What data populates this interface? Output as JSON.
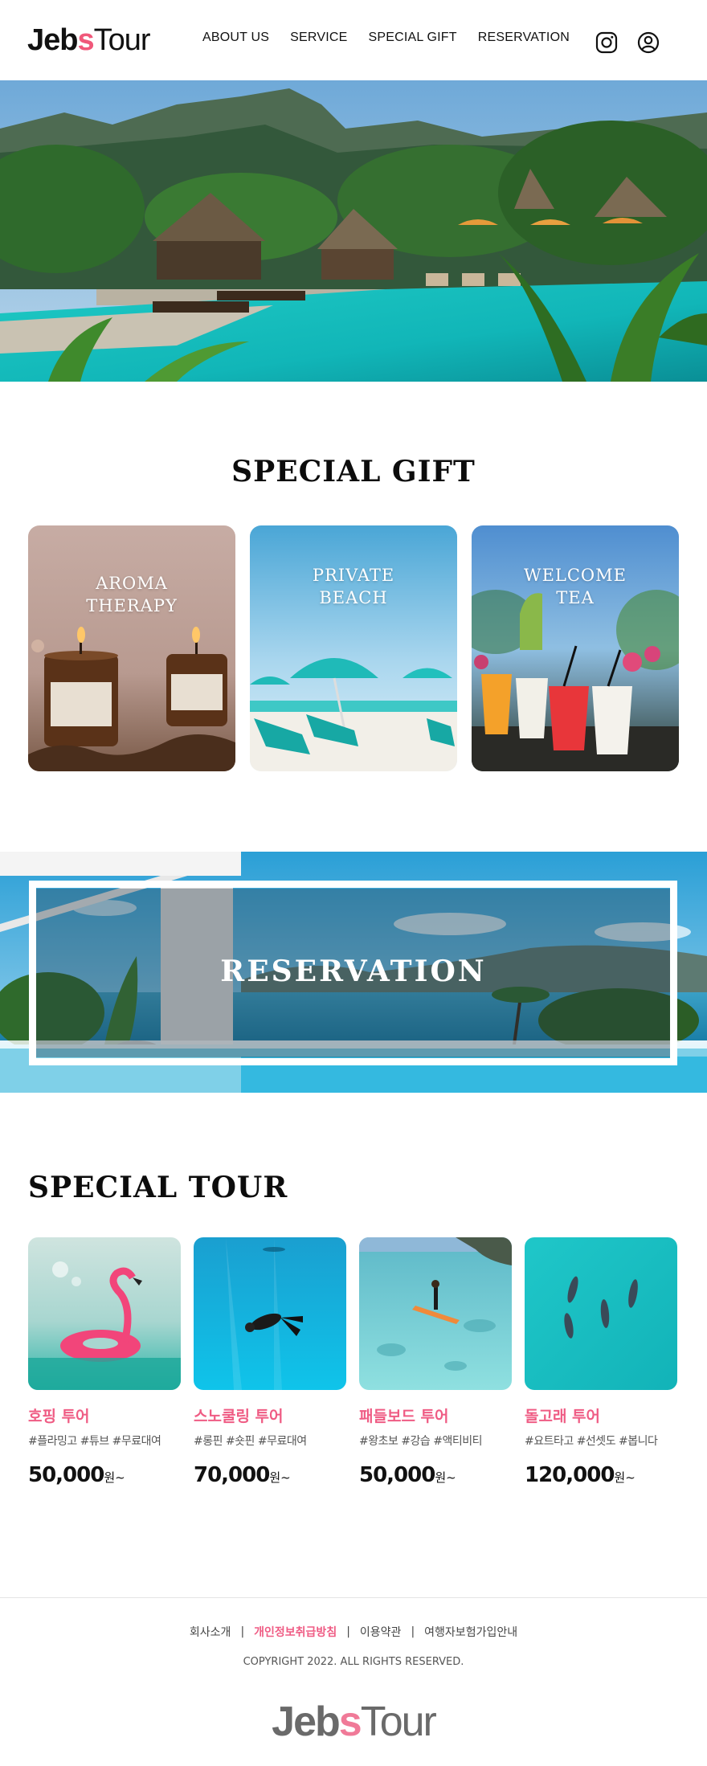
{
  "header": {
    "logo": {
      "part1": "Jeb",
      "part2": "s",
      "part3": "Tour"
    },
    "nav": [
      "ABOUT US",
      "SERVICE",
      "SPECIAL GIFT",
      "RESERVATION"
    ],
    "icons": [
      "instagram-icon",
      "user-icon"
    ]
  },
  "gift": {
    "title": "SPECIAL GIFT",
    "cards": [
      {
        "label": "AROMA THERAPY"
      },
      {
        "label": "PRIVATE BEACH"
      },
      {
        "label": "WELCOME TEA"
      }
    ]
  },
  "reservation": {
    "title": "RESERVATION"
  },
  "tour": {
    "title": "SPECIAL TOUR",
    "items": [
      {
        "name": "호핑 투어",
        "tags": "#플라밍고 #튜브 #무료대여",
        "price": "50,000",
        "unit": "원~"
      },
      {
        "name": "스노쿨링 투어",
        "tags": "#롱핀 #숏핀 #무료대여",
        "price": "70,000",
        "unit": "원~"
      },
      {
        "name": "패들보드 투어",
        "tags": "#왕초보 #강습 #액티비티",
        "price": "50,000",
        "unit": "원~"
      },
      {
        "name": "돌고래 투어",
        "tags": "#요트타고 #선셋도 #봅니다",
        "price": "120,000",
        "unit": "원~"
      }
    ]
  },
  "footer": {
    "links": [
      "회사소개",
      "개인정보취급방침",
      "이용약관",
      "여행자보험가입안내"
    ],
    "separator": "|",
    "copyright": "COPYRIGHT 2022. ALL RIGHTS RESERVED.",
    "logo": {
      "part1": "Jeb",
      "part2": "s",
      "part3": "Tour"
    }
  },
  "colors": {
    "accent": "#ef5c84",
    "text": "#111111",
    "footer_logo": "#6a6a6a"
  }
}
